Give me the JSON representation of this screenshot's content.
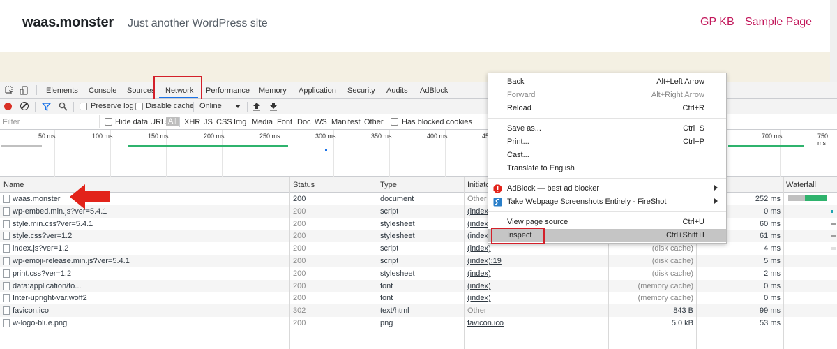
{
  "site": {
    "brand": "waas.monster",
    "tagline": "Just another WordPress site",
    "nav": [
      "GP KB",
      "Sample Page"
    ]
  },
  "devtools": {
    "tabs": [
      "Elements",
      "Console",
      "Sources",
      "Network",
      "Performance",
      "Memory",
      "Application",
      "Security",
      "Audits",
      "AdBlock"
    ],
    "active_tab": "Network",
    "toolbar": {
      "preserve_log": "Preserve log",
      "disable_cache": "Disable cache",
      "throttle": "Online"
    },
    "filter": {
      "placeholder": "Filter",
      "hide_data_urls": "Hide data URLs",
      "types": [
        "All",
        "XHR",
        "JS",
        "CSS",
        "Img",
        "Media",
        "Font",
        "Doc",
        "WS",
        "Manifest",
        "Other"
      ],
      "blocked_cookies": "Has blocked cookies"
    },
    "ruler": [
      "50 ms",
      "100 ms",
      "150 ms",
      "200 ms",
      "250 ms",
      "300 ms",
      "350 ms",
      "400 ms",
      "45",
      "700 ms",
      "750 ms"
    ],
    "columns": {
      "name": "Name",
      "status": "Status",
      "type": "Type",
      "initiator": "Initiato",
      "waterfall": "Waterfall"
    },
    "rows": [
      {
        "name": "waas.monster",
        "status": "200",
        "type": "document",
        "initiator": "Other",
        "size": "",
        "time": "252 ms"
      },
      {
        "name": "wp-embed.min.js?ver=5.4.1",
        "status": "200",
        "type": "script",
        "initiator": "(index)",
        "size": "",
        "time": "0 ms"
      },
      {
        "name": "style.min.css?ver=5.4.1",
        "status": "200",
        "type": "stylesheet",
        "initiator": "(index)",
        "size": "",
        "time": "60 ms"
      },
      {
        "name": "style.css?ver=1.2",
        "status": "200",
        "type": "stylesheet",
        "initiator": "(index)",
        "size": "",
        "time": "61 ms"
      },
      {
        "name": "index.js?ver=1.2",
        "status": "200",
        "type": "script",
        "initiator": "(index)",
        "size": "(disk cache)",
        "time": "4 ms"
      },
      {
        "name": "wp-emoji-release.min.js?ver=5.4.1",
        "status": "200",
        "type": "script",
        "initiator": "(index):19",
        "size": "(disk cache)",
        "time": "5 ms"
      },
      {
        "name": "print.css?ver=1.2",
        "status": "200",
        "type": "stylesheet",
        "initiator": "(index)",
        "size": "(disk cache)",
        "time": "2 ms"
      },
      {
        "name": "data:application/fo...",
        "status": "200",
        "type": "font",
        "initiator": "(index)",
        "size": "(memory cache)",
        "time": "0 ms"
      },
      {
        "name": "Inter-upright-var.woff2",
        "status": "200",
        "type": "font",
        "initiator": "(index)",
        "size": "(memory cache)",
        "time": "0 ms"
      },
      {
        "name": "favicon.ico",
        "status": "302",
        "type": "text/html",
        "initiator": "Other",
        "size": "843 B",
        "time": "99 ms"
      },
      {
        "name": "w-logo-blue.png",
        "status": "200",
        "type": "png",
        "initiator": "favicon.ico",
        "size": "5.0 kB",
        "time": "53 ms"
      }
    ]
  },
  "context_menu": {
    "items": [
      {
        "label": "Back",
        "shortcut": "Alt+Left Arrow"
      },
      {
        "label": "Forward",
        "shortcut": "Alt+Right Arrow"
      },
      {
        "label": "Reload",
        "shortcut": "Ctrl+R"
      },
      {
        "label": "Save as...",
        "shortcut": "Ctrl+S"
      },
      {
        "label": "Print...",
        "shortcut": "Ctrl+P"
      },
      {
        "label": "Cast...",
        "shortcut": ""
      },
      {
        "label": "Translate to English",
        "shortcut": ""
      },
      {
        "label": "AdBlock — best ad blocker",
        "shortcut": ""
      },
      {
        "label": "Take Webpage Screenshots Entirely - FireShot",
        "shortcut": ""
      },
      {
        "label": "View page source",
        "shortcut": "Ctrl+U"
      },
      {
        "label": "Inspect",
        "shortcut": "Ctrl+Shift+I"
      }
    ]
  },
  "colors": {
    "highlight": "#d3202a",
    "accent": "#1a73e8",
    "nav": "#c2185b"
  },
  "icons": [
    "inspect-element-icon",
    "device-toolbar-icon",
    "record-icon",
    "clear-icon",
    "filter-icon",
    "search-icon",
    "upload-icon",
    "download-icon",
    "file-icon",
    "adblock-icon",
    "fireshot-icon",
    "red-arrow-icon"
  ]
}
